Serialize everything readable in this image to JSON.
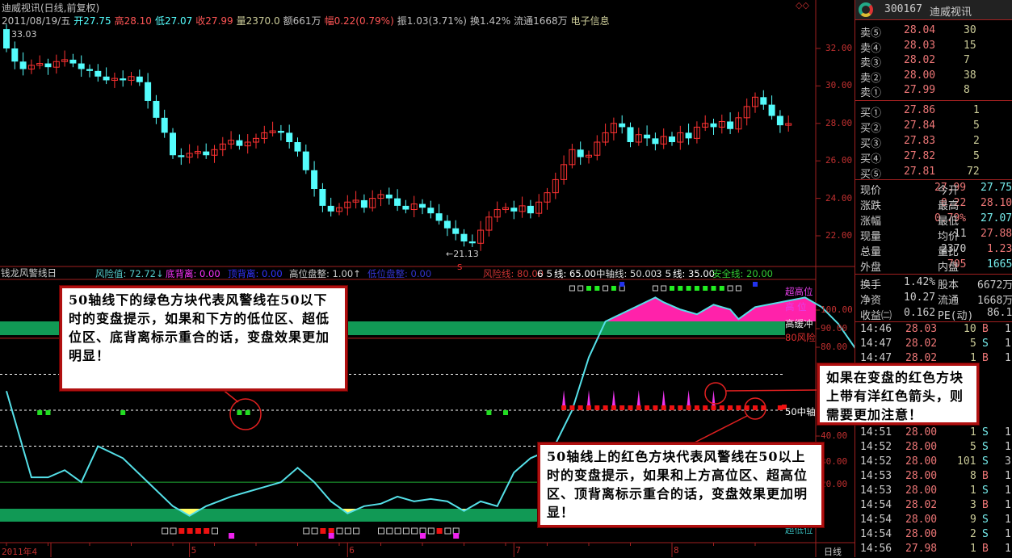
{
  "header": {
    "title": "迪威视讯(日线,前复权)",
    "quote": [
      {
        "t": "2011/08/19/五",
        "c": "#c0c0c0"
      },
      {
        "t": "开27.75",
        "c": "#5ff"
      },
      {
        "t": "高28.10",
        "c": "#f55"
      },
      {
        "t": "低27.07",
        "c": "#5ff"
      },
      {
        "t": "收27.99",
        "c": "#f55"
      },
      {
        "t": "量2370.0",
        "c": "#cc9"
      },
      {
        "t": "额661万",
        "c": "#c0c0c0"
      },
      {
        "t": "幅0.22(0.79%)",
        "c": "#f55"
      },
      {
        "t": "振1.03(3.71%)",
        "c": "#c0c0c0"
      },
      {
        "t": "换1.42%",
        "c": "#c0c0c0"
      },
      {
        "t": "流通1668万",
        "c": "#c0c0c0"
      },
      {
        "t": "电子信息",
        "c": "#cc9"
      }
    ],
    "corner_icon": "diamond-icon"
  },
  "price_chart": {
    "ylim": [
      21,
      33.5
    ],
    "yticks": [
      "32.00",
      "30.00",
      "28.00",
      "26.00",
      "24.00",
      "22.00"
    ],
    "ytick_values": [
      32,
      30,
      28,
      26,
      24,
      22
    ],
    "high_label": "33.03",
    "low_label": "←21.13",
    "marker_s": "S",
    "closes": [
      32.0,
      31.3,
      30.9,
      31.1,
      31.2,
      31.0,
      31.3,
      31.4,
      31.2,
      30.9,
      30.8,
      30.5,
      30.3,
      30.4,
      30.3,
      30.5,
      30.2,
      29.2,
      28.3,
      27.5,
      26.3,
      26.2,
      26.4,
      26.5,
      26.3,
      26.6,
      26.9,
      27.1,
      26.8,
      27.0,
      27.2,
      27.5,
      27.6,
      27.5,
      27.0,
      26.5,
      25.5,
      24.5,
      23.6,
      23.3,
      23.5,
      23.8,
      23.9,
      23.5,
      24.0,
      24.2,
      24.0,
      23.6,
      23.4,
      23.7,
      23.5,
      23.2,
      22.8,
      22.4,
      22.1,
      21.7,
      21.6,
      22.3,
      23.0,
      23.4,
      23.5,
      23.3,
      23.6,
      23.2,
      23.8,
      24.3,
      25.0,
      25.8,
      26.6,
      26.2,
      26.3,
      27.0,
      27.5,
      28.0,
      27.8,
      27.0,
      27.4,
      27.2,
      26.9,
      27.3,
      27.0,
      27.5,
      27.2,
      27.8,
      28.0,
      27.8,
      28.1,
      27.7,
      28.3,
      28.9,
      29.4,
      29.0,
      28.4,
      27.9,
      27.99
    ],
    "first_open": 33.03,
    "up_color": "#ff3232",
    "down_color": "#54fcfc"
  },
  "indicator": {
    "name": "钱龙风警线日",
    "fields": [
      {
        "t": "风险值: 72.72↓",
        "c": "#5cc"
      },
      {
        "t": "底背离: 0.00",
        "c": "#f3f"
      },
      {
        "t": "顶背离: 0.00",
        "c": "#33f"
      },
      {
        "t": "高位盘整: 1.00↑",
        "c": "#ccc"
      },
      {
        "t": "低位盘整: 0.00",
        "c": "#33c"
      },
      {
        "t": "风险线: 80.00",
        "c": "#c33"
      },
      {
        "t": "６５线: 65.00",
        "c": "#fff"
      },
      {
        "t": "中轴线: 50.00",
        "c": "#ddd"
      },
      {
        "t": "３５线: 35.00",
        "c": "#fff"
      },
      {
        "t": "安全线: 20.00",
        "c": "#3c3"
      }
    ],
    "yticks": [
      "100.00",
      "90.00",
      "80.00",
      "40.00",
      "30.00",
      "20.00"
    ],
    "levels": {
      "risk": 80,
      "l65": 65,
      "mid": 50,
      "l35": 35,
      "safe": 20
    },
    "labels": {
      "super_high": "超高位",
      "high": "高 位",
      "high_buffer": "高缓冲",
      "risk80": "80风险",
      "mid50": "50中轴",
      "super_low": "超低位"
    },
    "line": [
      [
        0,
        58
      ],
      [
        3,
        22
      ],
      [
        5,
        22
      ],
      [
        7,
        25
      ],
      [
        9,
        20
      ],
      [
        11,
        35
      ],
      [
        14,
        30
      ],
      [
        17,
        20
      ],
      [
        20,
        10
      ],
      [
        22,
        6
      ],
      [
        24,
        10
      ],
      [
        27,
        14
      ],
      [
        29,
        16
      ],
      [
        31,
        18
      ],
      [
        33,
        20
      ],
      [
        35,
        26
      ],
      [
        37,
        20
      ],
      [
        39,
        12
      ],
      [
        41,
        7
      ],
      [
        43,
        10
      ],
      [
        45,
        11
      ],
      [
        47,
        14
      ],
      [
        49,
        12
      ],
      [
        51,
        13
      ],
      [
        53,
        12
      ],
      [
        55,
        8
      ],
      [
        57,
        12
      ],
      [
        59,
        10
      ],
      [
        61,
        24
      ],
      [
        63,
        30
      ],
      [
        65,
        33
      ],
      [
        66,
        36
      ],
      [
        68,
        50
      ],
      [
        70,
        72
      ],
      [
        72,
        87
      ],
      [
        75,
        92
      ],
      [
        78,
        97
      ],
      [
        79,
        95
      ],
      [
        81,
        92
      ],
      [
        83,
        90
      ],
      [
        85,
        94
      ],
      [
        87,
        92
      ],
      [
        88,
        88
      ],
      [
        90,
        93
      ],
      [
        93,
        95
      ],
      [
        96,
        97
      ],
      [
        98,
        93
      ],
      [
        100,
        86
      ],
      [
        102,
        76
      ],
      [
        103,
        73
      ],
      [
        104,
        72.72
      ]
    ],
    "green_marks": [
      4,
      5,
      14,
      28,
      29,
      58,
      60
    ],
    "red_marks": [
      67,
      68,
      69,
      70,
      71,
      72,
      73,
      74,
      75,
      76,
      77,
      78,
      79,
      80,
      81,
      82,
      83,
      84,
      85,
      86,
      87,
      88,
      89,
      90,
      91,
      93
    ],
    "magenta_spikes": [
      67,
      70,
      73,
      76,
      79,
      82,
      85
    ],
    "top_marks": [
      {
        "i": 68,
        "f": 0
      },
      {
        "i": 69,
        "f": 0
      },
      {
        "i": 70,
        "f": 1
      },
      {
        "i": 71,
        "f": 1
      },
      {
        "i": 72,
        "f": 0
      },
      {
        "i": 73,
        "f": 1
      },
      {
        "i": 74,
        "f": 0
      },
      {
        "i": 78,
        "f": 0
      },
      {
        "i": 79,
        "f": 0
      },
      {
        "i": 80,
        "f": 1
      },
      {
        "i": 81,
        "f": 1
      },
      {
        "i": 82,
        "f": 1
      },
      {
        "i": 83,
        "f": 1
      },
      {
        "i": 84,
        "f": 1
      },
      {
        "i": 85,
        "f": 1
      },
      {
        "i": 86,
        "f": 1
      },
      {
        "i": 87,
        "f": 0
      },
      {
        "i": 88,
        "f": 0
      }
    ],
    "bottom_marks": [
      {
        "i": 19,
        "f": 0
      },
      {
        "i": 20,
        "f": 0
      },
      {
        "i": 21,
        "f": 1
      },
      {
        "i": 22,
        "f": 1
      },
      {
        "i": 23,
        "f": 1
      },
      {
        "i": 24,
        "f": 1
      },
      {
        "i": 25,
        "f": 0
      },
      {
        "i": 36,
        "f": 0
      },
      {
        "i": 37,
        "f": 0
      },
      {
        "i": 38,
        "f": 1
      },
      {
        "i": 39,
        "f": 1
      },
      {
        "i": 40,
        "f": 0
      },
      {
        "i": 41,
        "f": 0
      },
      {
        "i": 42,
        "f": 0
      },
      {
        "i": 45,
        "f": 0
      },
      {
        "i": 46,
        "f": 0
      },
      {
        "i": 47,
        "f": 0
      },
      {
        "i": 48,
        "f": 0
      },
      {
        "i": 49,
        "f": 0
      },
      {
        "i": 50,
        "f": 0
      },
      {
        "i": 51,
        "f": 0
      },
      {
        "i": 52,
        "f": 1
      },
      {
        "i": 53,
        "f": 0
      },
      {
        "i": 54,
        "f": 0
      }
    ],
    "bottom_spikes": [
      27,
      39,
      50,
      54
    ]
  },
  "xaxis": {
    "labels": [
      {
        "t": "2011年4",
        "i": 0
      },
      {
        "t": "5",
        "i": 22
      },
      {
        "t": "6",
        "i": 41
      },
      {
        "t": "7",
        "i": 61
      },
      {
        "t": "8",
        "i": 80
      }
    ],
    "period": "日线"
  },
  "callouts": {
    "green": "50轴线下的绿色方块代表风警线在50以下时的变盘提示，如果和下方的低位区、超低位区、底背离标示重合的话，变盘效果更加明显！",
    "red": "50轴线上的红色方块代表风警线在50以上时的变盘提示，如果和上方高位区、超高位区、顶背离标示重合的话，变盘效果更加明显！",
    "arrow": "如果在变盘的红色方块上带有洋红色箭头，则需要更加注意！"
  },
  "panel": {
    "code": "300167",
    "name": "迪威视讯",
    "asks": [
      {
        "l": "卖⑤",
        "p": "28.04",
        "v": "30"
      },
      {
        "l": "卖④",
        "p": "28.03",
        "v": "15"
      },
      {
        "l": "卖③",
        "p": "28.02",
        "v": "7"
      },
      {
        "l": "卖②",
        "p": "28.00",
        "v": "38"
      },
      {
        "l": "卖①",
        "p": "27.99",
        "v": "8"
      }
    ],
    "bids": [
      {
        "l": "买①",
        "p": "27.86",
        "v": "1"
      },
      {
        "l": "买②",
        "p": "27.84",
        "v": "5"
      },
      {
        "l": "买③",
        "p": "27.83",
        "v": "2"
      },
      {
        "l": "买④",
        "p": "27.82",
        "v": "5"
      },
      {
        "l": "买⑤",
        "p": "27.81",
        "v": "72"
      }
    ],
    "stats": [
      {
        "a": "现价",
        "b": "27.99",
        "bc": "#e77",
        "c": "今开",
        "d": "27.75",
        "dc": "#7ee"
      },
      {
        "a": "涨跌",
        "b": "0.22",
        "bc": "#e77",
        "c": "最高",
        "d": "28.10",
        "dc": "#e77"
      },
      {
        "a": "涨幅",
        "b": "0.79%",
        "bc": "#e77",
        "c": "最低",
        "d": "27.07",
        "dc": "#7ee"
      },
      {
        "a": "现量",
        "b": "11",
        "bc": "#ccc",
        "c": "均价",
        "d": "27.88",
        "dc": "#e77"
      },
      {
        "a": "总量",
        "b": "2370",
        "bc": "#ccc",
        "c": "量比",
        "d": "1.23",
        "dc": "#e77"
      },
      {
        "a": "外盘",
        "b": "705",
        "bc": "#e77",
        "c": "内盘",
        "d": "1665",
        "dc": "#7ee"
      }
    ],
    "stats2": [
      {
        "a": "换手",
        "b": "1.42%",
        "c": "股本",
        "d": "6672万"
      },
      {
        "a": "净资",
        "b": "10.27",
        "c": "流通",
        "d": "1668万"
      },
      {
        "a": "收益㈡",
        "b": "0.162",
        "c": "PE(动)",
        "d": "86.1"
      }
    ],
    "ticks_top": [
      {
        "t": "14:46",
        "p": "28.03",
        "v": "10",
        "s": "B",
        "n": "1"
      },
      {
        "t": "14:47",
        "p": "28.02",
        "v": "5",
        "s": "S",
        "n": "1"
      },
      {
        "t": "14:47",
        "p": "28.02",
        "v": "1",
        "s": "B",
        "n": "1"
      }
    ],
    "ticks": [
      {
        "t": "14:51",
        "p": "28.00",
        "v": "1",
        "s": "S",
        "n": "1"
      },
      {
        "t": "14:52",
        "p": "28.00",
        "v": "5",
        "s": "S",
        "n": "1"
      },
      {
        "t": "14:52",
        "p": "28.00",
        "v": "101",
        "s": "S",
        "n": "3"
      },
      {
        "t": "14:53",
        "p": "28.00",
        "v": "8",
        "s": "B",
        "n": "1"
      },
      {
        "t": "14:53",
        "p": "28.00",
        "v": "1",
        "s": "S",
        "n": "1"
      },
      {
        "t": "14:54",
        "p": "28.02",
        "v": "3",
        "s": "B",
        "n": "1"
      },
      {
        "t": "14:54",
        "p": "28.00",
        "v": "9",
        "s": "S",
        "n": "1"
      },
      {
        "t": "14:54",
        "p": "28.00",
        "v": "2",
        "s": "S",
        "n": "1"
      },
      {
        "t": "14:56",
        "p": "27.98",
        "v": "1",
        "s": "B",
        "n": "1"
      }
    ]
  }
}
